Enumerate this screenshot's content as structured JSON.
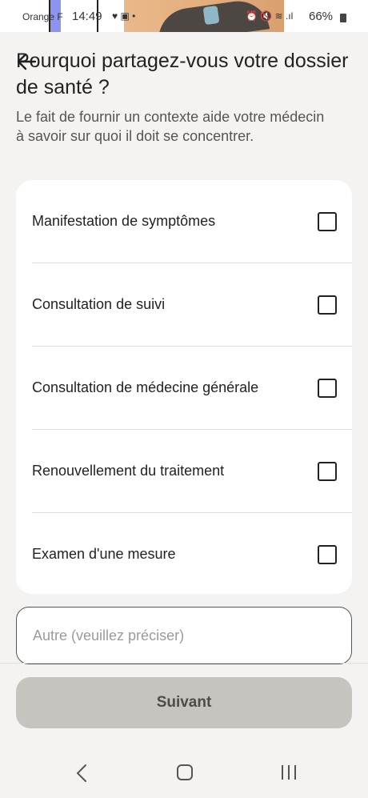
{
  "status_bar": {
    "carrier": "Orange F",
    "time": "14:49",
    "left_icons": "♥ ▣ •",
    "right_icons": "⏰ 🔇 ≋ .ıl",
    "battery": "66%"
  },
  "header": {
    "back_icon": "back-arrow-icon",
    "title": "Pourquoi partagez-vous votre dossier de santé ?",
    "subtitle": "Le fait de fournir un contexte aide votre médecin à savoir sur quoi il doit se concentrer."
  },
  "options": [
    {
      "label": "Manifestation de symptômes",
      "checked": false
    },
    {
      "label": "Consultation de suivi",
      "checked": false
    },
    {
      "label": "Consultation de médecine générale",
      "checked": false
    },
    {
      "label": "Renouvellement du traitement",
      "checked": false
    },
    {
      "label": "Examen d'une mesure",
      "checked": false
    }
  ],
  "other_input": {
    "placeholder": "Autre (veuillez préciser)",
    "value": ""
  },
  "next_button": {
    "label": "Suivant"
  },
  "colors": {
    "background": "#f4f3f1",
    "card": "#ffffff",
    "button_disabled": "#c7c3bf",
    "text_primary": "#222222"
  }
}
